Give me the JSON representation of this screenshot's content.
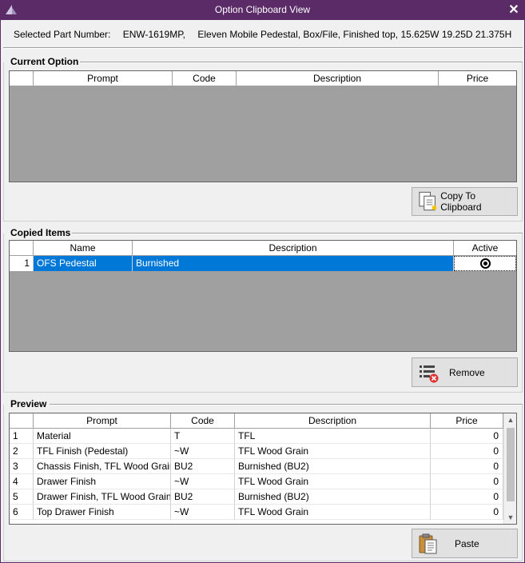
{
  "window": {
    "title": "Option Clipboard View",
    "close_glyph": "✕",
    "accent": "#5b2b67"
  },
  "part": {
    "label": "Selected Part Number:",
    "number": "ENW-1619MP,",
    "description": "Eleven Mobile Pedestal, Box/File, Finished top, 15.625W 19.25D 21.375H"
  },
  "current_option": {
    "title": "Current Option",
    "columns": [
      "Prompt",
      "Code",
      "Description",
      "Price"
    ],
    "copy_button": "Copy To Clipboard"
  },
  "copied_items": {
    "title": "Copied Items",
    "columns": [
      "Name",
      "Description",
      "Active"
    ],
    "rows": [
      {
        "num": "1",
        "name": "OFS Pedestal",
        "description": "Burnished",
        "active": true
      }
    ],
    "remove_button": "Remove"
  },
  "preview": {
    "title": "Preview",
    "columns": [
      "Prompt",
      "Code",
      "Description",
      "Price"
    ],
    "rows": [
      {
        "num": "1",
        "prompt": "Material",
        "code": "T",
        "description": "TFL",
        "price": "0"
      },
      {
        "num": "2",
        "prompt": "TFL Finish (Pedestal)",
        "code": "~W",
        "description": "TFL Wood Grain",
        "price": "0"
      },
      {
        "num": "3",
        "prompt": "Chassis Finish, TFL Wood Grain",
        "code": "BU2",
        "description": "Burnished (BU2)",
        "price": "0"
      },
      {
        "num": "4",
        "prompt": "Drawer Finish",
        "code": "~W",
        "description": "TFL Wood Grain",
        "price": "0"
      },
      {
        "num": "5",
        "prompt": "Drawer Finish, TFL Wood Grain",
        "code": "BU2",
        "description": "Burnished (BU2)",
        "price": "0"
      },
      {
        "num": "6",
        "prompt": "Top Drawer Finish",
        "code": "~W",
        "description": "TFL Wood Grain",
        "price": "0"
      }
    ],
    "paste_button": "Paste"
  }
}
